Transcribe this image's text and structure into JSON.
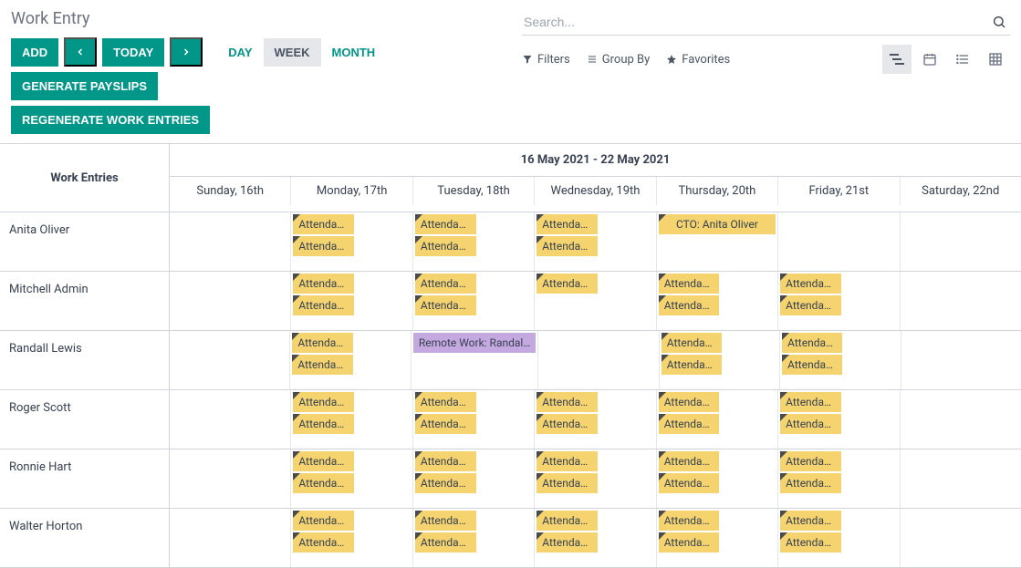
{
  "title": "Work Entry",
  "search": {
    "placeholder": "Search..."
  },
  "buttons": {
    "add": "ADD",
    "today": "TODAY",
    "generate": "GENERATE PAYSLIPS",
    "regenerate": "REGENERATE WORK ENTRIES"
  },
  "views": {
    "day": "DAY",
    "week": "WEEK",
    "month": "MONTH"
  },
  "filters": {
    "filters": "Filters",
    "groupby": "Group By",
    "favorites": "Favorites"
  },
  "dateRange": "16 May 2021 - 22 May 2021",
  "rowHeader": "Work Entries",
  "days": [
    "Sunday, 16th",
    "Monday, 17th",
    "Tuesday, 18th",
    "Wednesday, 19th",
    "Thursday, 20th",
    "Friday, 21st",
    "Saturday, 22nd"
  ],
  "employees": [
    {
      "name": "Anita Oliver",
      "cells": [
        [],
        [
          {
            "label": "Attendan…",
            "type": "att"
          },
          {
            "label": "Attendan…",
            "type": "att"
          }
        ],
        [
          {
            "label": "Attendan…",
            "type": "att"
          },
          {
            "label": "Attendan…",
            "type": "att"
          }
        ],
        [
          {
            "label": "Attendan…",
            "type": "att"
          },
          {
            "label": "Attendan…",
            "type": "att"
          }
        ],
        [
          {
            "label": "CTO: Anita Oliver",
            "type": "cto"
          }
        ],
        [],
        []
      ]
    },
    {
      "name": "Mitchell Admin",
      "cells": [
        [],
        [
          {
            "label": "Attendan…",
            "type": "att"
          },
          {
            "label": "Attendan…",
            "type": "att"
          }
        ],
        [
          {
            "label": "Attendan…",
            "type": "att"
          },
          {
            "label": "Attendan…",
            "type": "att"
          }
        ],
        [
          {
            "label": "Attendan…",
            "type": "att"
          }
        ],
        [
          {
            "label": "Attendan…",
            "type": "att"
          },
          {
            "label": "Attendan…",
            "type": "att"
          }
        ],
        [
          {
            "label": "Attendan…",
            "type": "att"
          },
          {
            "label": "Attendan…",
            "type": "att"
          }
        ],
        []
      ]
    },
    {
      "name": "Randall Lewis",
      "cells": [
        [],
        [
          {
            "label": "Attendan…",
            "type": "att"
          },
          {
            "label": "Attendan…",
            "type": "att"
          }
        ],
        [
          {
            "label": "Remote Work: Randal…",
            "type": "remote"
          }
        ],
        [],
        [
          {
            "label": "Attendan…",
            "type": "att"
          },
          {
            "label": "Attendan…",
            "type": "att"
          }
        ],
        [
          {
            "label": "Attendan…",
            "type": "att"
          },
          {
            "label": "Attendan…",
            "type": "att"
          }
        ],
        []
      ]
    },
    {
      "name": "Roger Scott",
      "cells": [
        [],
        [
          {
            "label": "Attendan…",
            "type": "att"
          },
          {
            "label": "Attendan…",
            "type": "att"
          }
        ],
        [
          {
            "label": "Attendan…",
            "type": "att"
          },
          {
            "label": "Attendan…",
            "type": "att"
          }
        ],
        [
          {
            "label": "Attendan…",
            "type": "att"
          },
          {
            "label": "Attendan…",
            "type": "att"
          }
        ],
        [
          {
            "label": "Attendan…",
            "type": "att"
          },
          {
            "label": "Attendan…",
            "type": "att"
          }
        ],
        [
          {
            "label": "Attendan…",
            "type": "att"
          },
          {
            "label": "Attendan…",
            "type": "att"
          }
        ],
        []
      ]
    },
    {
      "name": "Ronnie Hart",
      "cells": [
        [],
        [
          {
            "label": "Attendan…",
            "type": "att"
          },
          {
            "label": "Attendan…",
            "type": "att"
          }
        ],
        [
          {
            "label": "Attendan…",
            "type": "att"
          },
          {
            "label": "Attendan…",
            "type": "att"
          }
        ],
        [
          {
            "label": "Attendan…",
            "type": "att"
          },
          {
            "label": "Attendan…",
            "type": "att"
          }
        ],
        [
          {
            "label": "Attendan…",
            "type": "att"
          },
          {
            "label": "Attendan…",
            "type": "att"
          }
        ],
        [
          {
            "label": "Attendan…",
            "type": "att"
          },
          {
            "label": "Attendan…",
            "type": "att"
          }
        ],
        []
      ]
    },
    {
      "name": "Walter Horton",
      "cells": [
        [],
        [
          {
            "label": "Attendan…",
            "type": "att"
          },
          {
            "label": "Attendan…",
            "type": "att"
          }
        ],
        [
          {
            "label": "Attendan…",
            "type": "att"
          },
          {
            "label": "Attendan…",
            "type": "att"
          }
        ],
        [
          {
            "label": "Attendan…",
            "type": "att"
          },
          {
            "label": "Attendan…",
            "type": "att"
          }
        ],
        [
          {
            "label": "Attendan…",
            "type": "att"
          },
          {
            "label": "Attendan…",
            "type": "att"
          }
        ],
        [
          {
            "label": "Attendan…",
            "type": "att"
          },
          {
            "label": "Attendan…",
            "type": "att"
          }
        ],
        []
      ]
    }
  ]
}
